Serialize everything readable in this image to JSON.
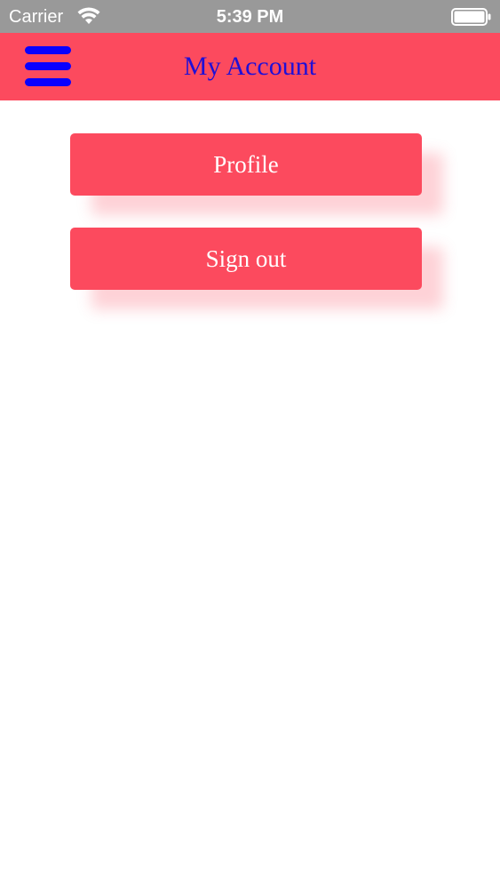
{
  "status_bar": {
    "carrier": "Carrier",
    "time": "5:39 PM",
    "wifi_icon": "wifi-icon",
    "battery_icon": "battery-icon"
  },
  "header": {
    "title": "My Account",
    "menu_icon": "hamburger-menu-icon"
  },
  "buttons": {
    "profile_label": "Profile",
    "signout_label": "Sign out"
  },
  "colors": {
    "accent": "#fc4a5e",
    "menu_icon": "#0a00ff",
    "title_text": "#1f0fd6",
    "button_text": "#ffffff",
    "status_bar_bg": "#999999"
  }
}
